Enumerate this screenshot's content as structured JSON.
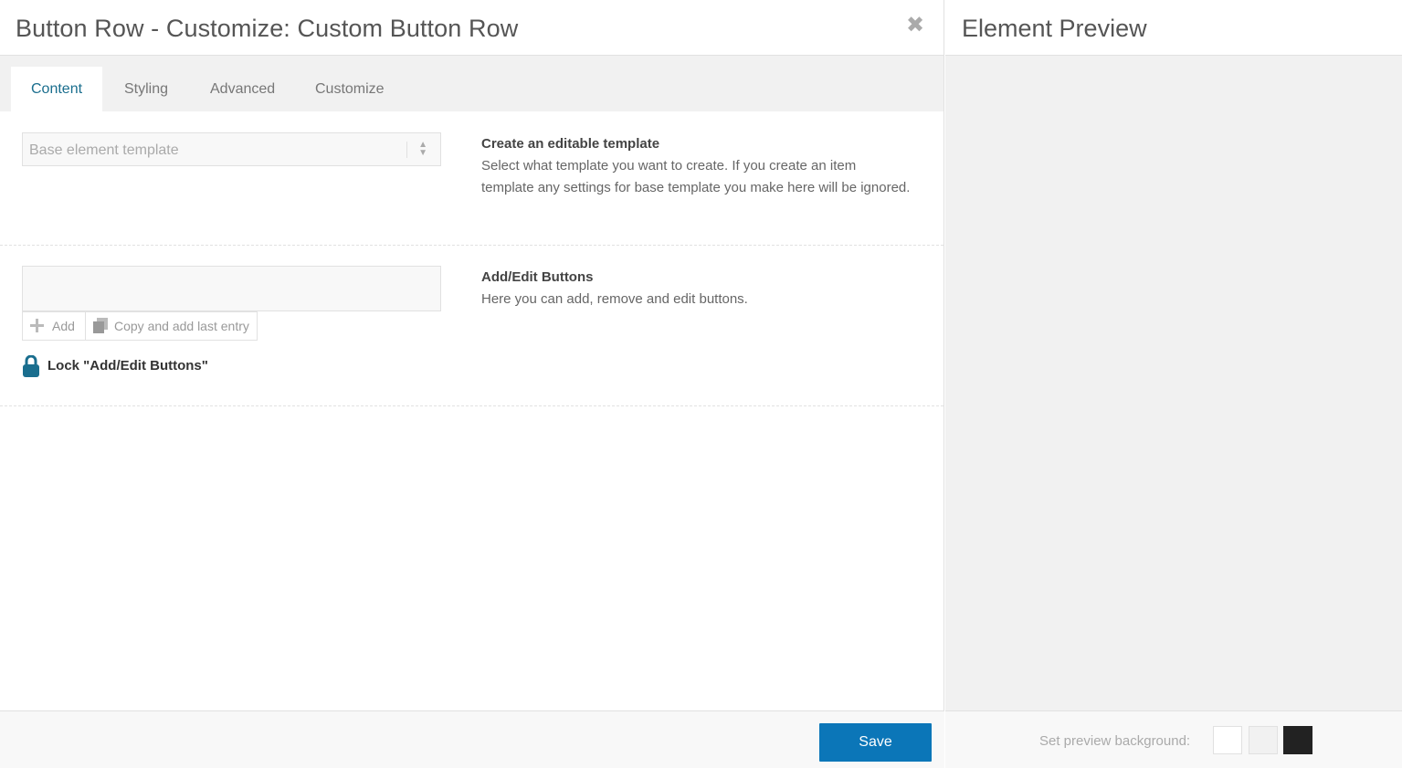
{
  "editor": {
    "title": "Button Row - Customize: Custom Button Row",
    "close_icon": "close-icon",
    "tabs": [
      {
        "label": "Content",
        "active": true
      },
      {
        "label": "Styling",
        "active": false
      },
      {
        "label": "Advanced",
        "active": false
      },
      {
        "label": "Customize",
        "active": false
      }
    ],
    "template_section": {
      "select_value": "Base element template",
      "title": "Create an editable template",
      "description": "Select what template you want to create. If you create an item template any settings for base template you make here will be ignored."
    },
    "buttons_section": {
      "add_label": "Add",
      "copy_label": "Copy and add last entry",
      "lock_label": "Lock \"Add/Edit Buttons\"",
      "title": "Add/Edit Buttons",
      "description": "Here you can add, remove and edit buttons."
    },
    "save_label": "Save"
  },
  "preview": {
    "title": "Element Preview",
    "background_label": "Set preview background:",
    "swatches": [
      "#ffffff",
      "#f1f1f1",
      "#222222"
    ]
  },
  "colors": {
    "accent": "#0b76b8",
    "active_tab_text": "#1a6e8e",
    "lock_icon": "#1a6e8e"
  }
}
